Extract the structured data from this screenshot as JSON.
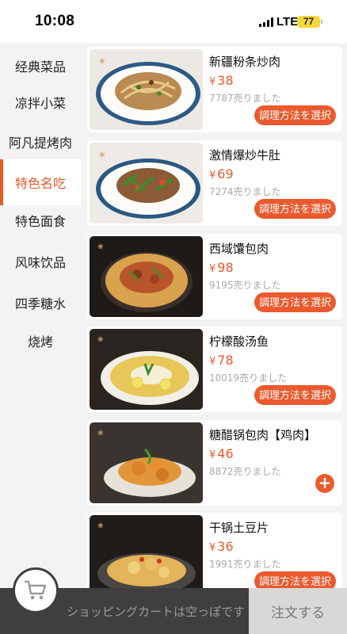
{
  "status_bar": {
    "time": "10:08",
    "network": "LTE",
    "battery": "77"
  },
  "sidebar": {
    "active_index": 3,
    "items": [
      {
        "label": "经典菜品"
      },
      {
        "label": "凉拌小菜"
      },
      {
        "label": "阿凡提烤肉"
      },
      {
        "label": "特色名吃"
      },
      {
        "label": "特色面食"
      },
      {
        "label": "风味饮品"
      },
      {
        "label": "四季糖水"
      },
      {
        "label": "烧烤"
      }
    ]
  },
  "products": [
    {
      "name": "新疆粉条炒肉",
      "currency": "¥",
      "price": "38",
      "sold": "7787売りました",
      "action": "調理方法を選択"
    },
    {
      "name": "激情爆炒牛肚",
      "currency": "¥",
      "price": "69",
      "sold": "7274売りました",
      "action": "調理方法を選択"
    },
    {
      "name": "西域馕包肉",
      "currency": "¥",
      "price": "98",
      "sold": "9195売りました",
      "action": "調理方法を選択"
    },
    {
      "name": "柠檬酸汤鱼",
      "currency": "¥",
      "price": "78",
      "sold": "10019売りました",
      "action": "調理方法を選択"
    },
    {
      "name": "糖醋锅包肉【鸡肉】",
      "currency": "¥",
      "price": "46",
      "sold": "8872売りました",
      "action": "+"
    },
    {
      "name": "干锅土豆片",
      "currency": "¥",
      "price": "36",
      "sold": "1991売りました",
      "action": "調理方法を選択"
    }
  ],
  "cart": {
    "empty_text": "ショッピングカートは空っぽです",
    "checkout_label": "注文する"
  },
  "colors": {
    "accent": "#ea5a2e",
    "cart_bar": "#3f3f3f",
    "checkout_disabled": "#d8d8d8"
  }
}
